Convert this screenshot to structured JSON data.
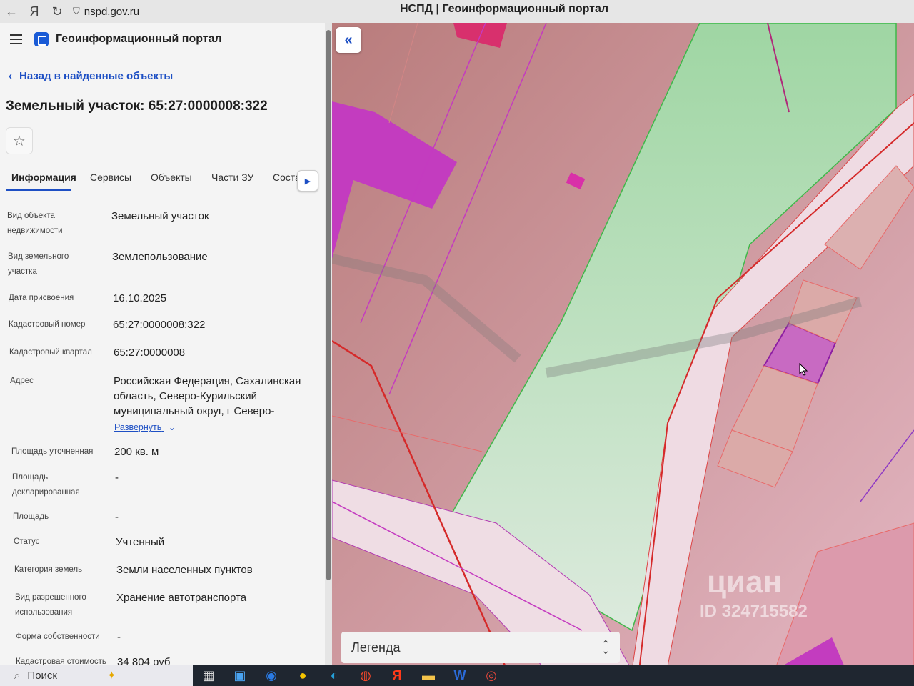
{
  "browser": {
    "url": "nspd.gov.ru",
    "tab_title": "НСПД | Геоинформационный портал"
  },
  "header": {
    "title": "Геоинформационный портал"
  },
  "nav": {
    "back_label": "Назад в найденные объекты"
  },
  "object": {
    "title": "Земельный участок: 65:27:0000008:322"
  },
  "tabs": [
    "Информация",
    "Сервисы",
    "Объекты",
    "Части ЗУ",
    "Соста"
  ],
  "fields": [
    {
      "label": "Вид объекта недвижимости",
      "value": "Земельный участок"
    },
    {
      "label": "Вид земельного участка",
      "value": "Землепользование"
    },
    {
      "label": "Дата присвоения",
      "value": "16.10.2025"
    },
    {
      "label": "Кадастровый номер",
      "value": "65:27:0000008:322"
    },
    {
      "label": "Кадастровый квартал",
      "value": "65:27:0000008"
    },
    {
      "label": "Адрес",
      "value": "Российская Федерация, Сахалинская область, Северо-Курильский муниципальный округ, г Северо-"
    },
    {
      "label": "Площадь уточненная",
      "value": "200 кв. м"
    },
    {
      "label": "Площадь декларированная",
      "value": "-"
    },
    {
      "label": "Площадь",
      "value": "-"
    },
    {
      "label": "Статус",
      "value": "Учтенный"
    },
    {
      "label": "Категория земель",
      "value": "Земли населенных пунктов"
    },
    {
      "label": "Вид разрешенного использования",
      "value": "Хранение автотранспорта"
    },
    {
      "label": "Форма собственности",
      "value": "-"
    },
    {
      "label": "Кадастровая стоимость",
      "value": "34 804 руб"
    }
  ],
  "address_expand": "Развернуть",
  "map": {
    "legend_label": "Легенда",
    "watermark": "циан",
    "watermark_id": "ID 324715582"
  },
  "taskbar": {
    "search_label": "Поиск"
  }
}
